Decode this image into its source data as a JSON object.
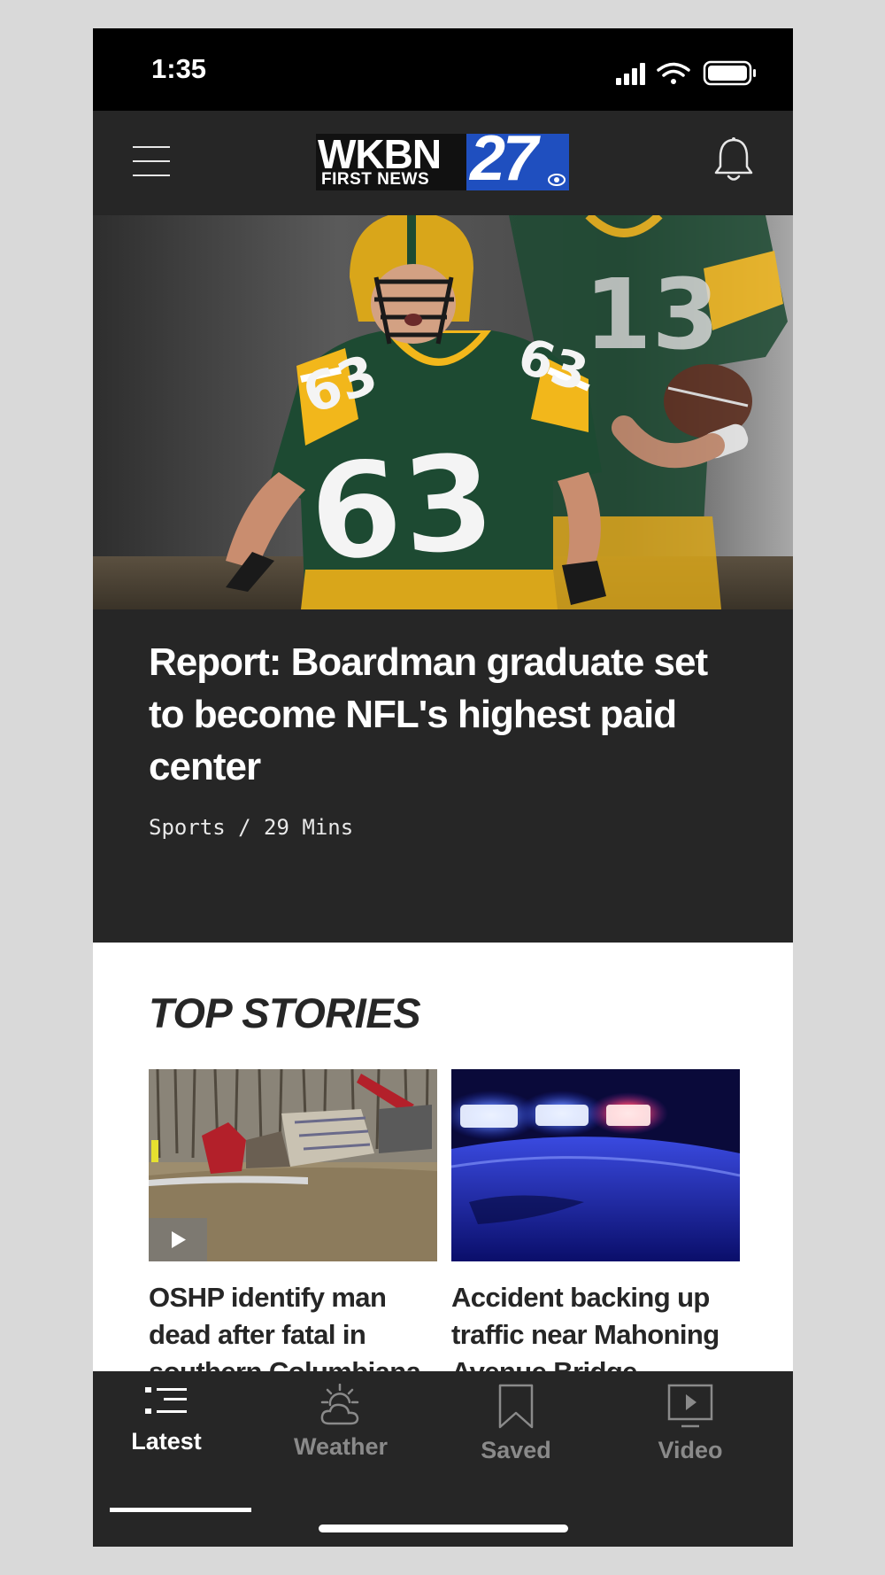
{
  "status_bar": {
    "time": "1:35"
  },
  "header": {
    "logo": {
      "call_letters": "WKBN",
      "tagline": "FIRST NEWS",
      "channel": "27"
    },
    "menu_icon": "hamburger-menu-icon",
    "notifications_icon": "bell-icon"
  },
  "hero": {
    "image": "football-player-63-photo",
    "title": "Report: Boardman graduate set to become NFL's highest paid center",
    "meta": "Sports / 29 Mins"
  },
  "top_stories": {
    "heading": "TOP STORIES",
    "items": [
      {
        "image": "crash-debris-field-photo",
        "has_video": true,
        "title": "OSHP identify man dead after fatal in southern Columbiana"
      },
      {
        "image": "police-lights-photo",
        "has_video": false,
        "title": "Accident backing up traffic near Mahoning Avenue Bridge"
      }
    ]
  },
  "bottom_nav": {
    "items": [
      {
        "label": "Latest",
        "icon": "list-icon",
        "active": true
      },
      {
        "label": "Weather",
        "icon": "sun-cloud-icon",
        "active": false
      },
      {
        "label": "Saved",
        "icon": "bookmark-icon",
        "active": false
      },
      {
        "label": "Video",
        "icon": "video-play-icon",
        "active": false
      }
    ]
  },
  "colors": {
    "header_bg": "#262626",
    "logo_blue": "#1f4fbf",
    "nav_active": "#ffffff",
    "nav_inactive": "#8a8a8a",
    "packers_green": "#1d4a32",
    "packers_gold": "#f2b71b"
  }
}
